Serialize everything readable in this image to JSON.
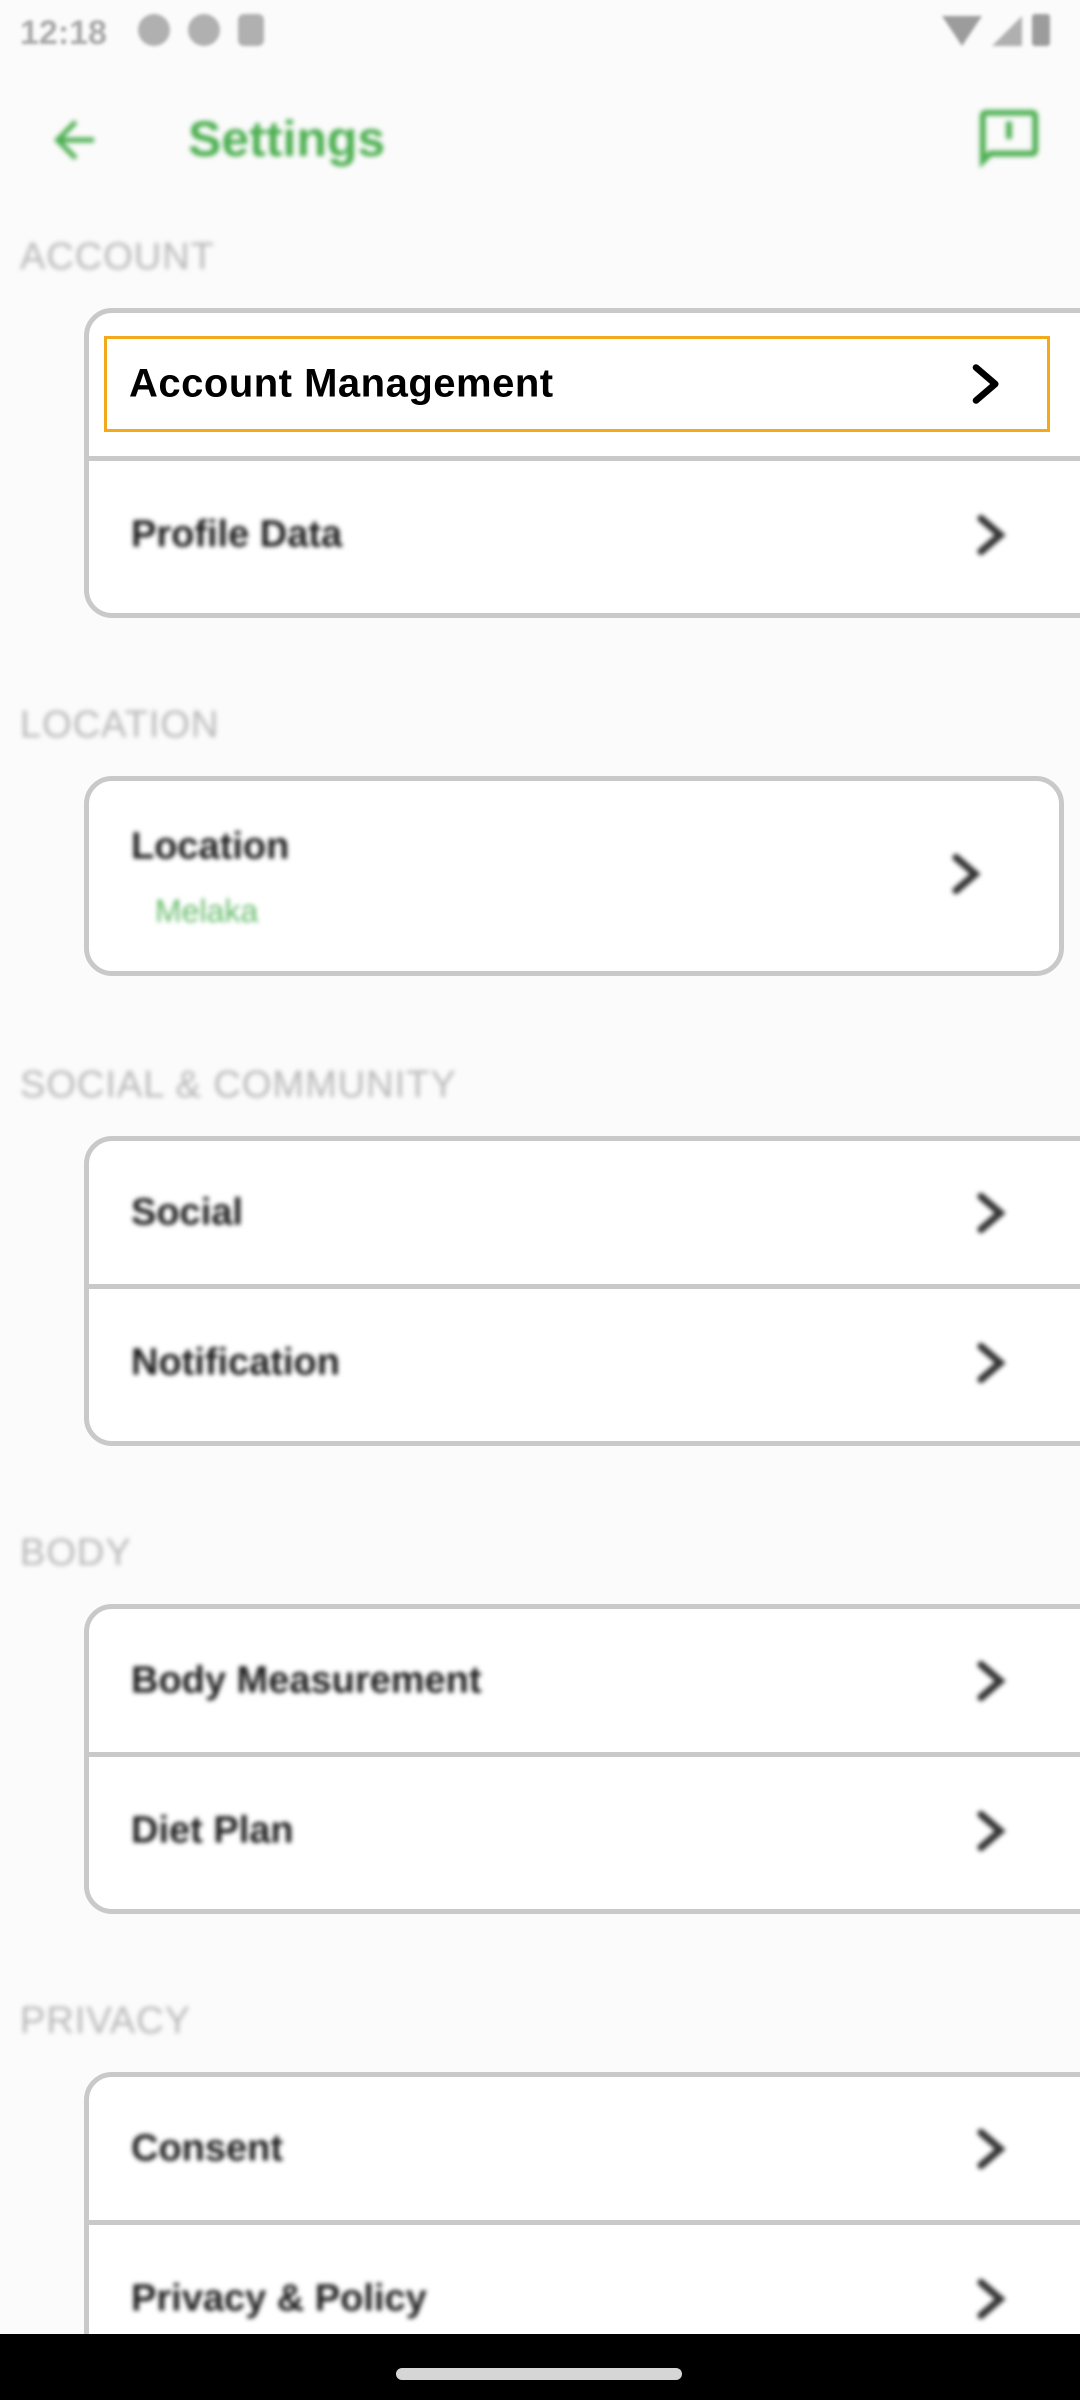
{
  "status_bar": {
    "time": "12:18"
  },
  "app_bar": {
    "title": "Settings",
    "back_icon": "arrow-left-icon",
    "feedback_icon": "feedback-icon",
    "accent_color": "#4caf50"
  },
  "sections": [
    {
      "header": "ACCOUNT",
      "items": [
        {
          "label": "Account Management"
        },
        {
          "label": "Profile Data"
        }
      ]
    },
    {
      "header": "LOCATION",
      "items": [
        {
          "label": "Location",
          "value": "Melaka"
        }
      ]
    },
    {
      "header": "SOCIAL & COMMUNITY",
      "items": [
        {
          "label": "Social"
        },
        {
          "label": "Notification"
        }
      ]
    },
    {
      "header": "BODY",
      "items": [
        {
          "label": "Body Measurement"
        },
        {
          "label": "Diet Plan"
        }
      ]
    },
    {
      "header": "PRIVACY",
      "items": [
        {
          "label": "Consent"
        },
        {
          "label": "Privacy & Policy"
        }
      ]
    }
  ],
  "highlight_color": "#f2a91b"
}
